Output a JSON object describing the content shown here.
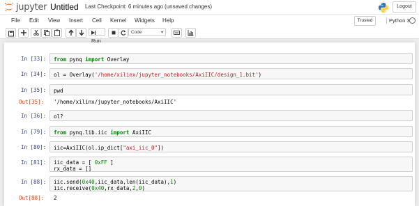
{
  "header": {
    "logo_text": "jupyter",
    "notebook_title": "Untitled",
    "checkpoint": "Last Checkpoint: 6 minutes ago",
    "autosave_status": "(unsaved changes)",
    "logout_label": "Logout"
  },
  "menu": {
    "items": [
      "File",
      "Edit",
      "View",
      "Insert",
      "Cell",
      "Kernel",
      "Widgets",
      "Help"
    ],
    "trusted_label": "Trusted",
    "kernel_name": "Python 3"
  },
  "toolbar": {
    "run_label": "Run",
    "cell_type": "Code",
    "icons": [
      "save-icon",
      "plus-icon",
      "scissors-icon",
      "copy-icon",
      "paste-icon",
      "arrow-up-icon",
      "arrow-down-icon",
      "run-icon",
      "stop-icon",
      "restart-icon",
      "keyboard-icon",
      "chart-icon"
    ]
  },
  "colors": {
    "prompt_in": "#303f9f",
    "prompt_out": "#d84315",
    "keyword": "#008000",
    "string": "#ba2121",
    "logo_orange": "#f37726",
    "python_blue": "#3776ab",
    "python_yellow": "#ffd43b"
  },
  "cells": [
    {
      "prompt": "In [33]:",
      "lines": [
        [
          "from",
          " pynq ",
          "import",
          " Overlay"
        ]
      ]
    },
    {
      "prompt": "In [34]:",
      "lines": [
        [
          "ol = Overlay(",
          "'/home/xilinx/jupyter_notebooks/AxiIIC/design_1.bit'",
          ")"
        ]
      ]
    },
    {
      "prompt": "In [35]:",
      "lines": [
        [
          "pwd"
        ]
      ],
      "output_prompt": "Out[35]:",
      "output": "'/home/xilinx/jupyter_notebooks/AxiIIC'"
    },
    {
      "prompt": "In [36]:",
      "lines": [
        [
          "ol?"
        ]
      ]
    },
    {
      "prompt": "In [79]:",
      "lines": [
        [
          "from",
          " pynq.lib.iic ",
          "import",
          " AxiIIC"
        ]
      ]
    },
    {
      "prompt": "In [80]:",
      "lines": [
        [
          "iic=AxiIIC(ol.ip_dict[",
          "\"axi_iic_0\"",
          "])"
        ]
      ]
    },
    {
      "prompt": "In [81]:",
      "lines": [
        [
          "iic_data = [ ",
          "0xFF",
          " ]"
        ],
        [
          "rx_data = []"
        ]
      ]
    },
    {
      "prompt": "In [88]:",
      "lines": [
        [
          "iic.send(",
          "0x40",
          ",iic_data,len(iic_data),",
          "1",
          ")"
        ],
        [
          "iic.receive(",
          "0x40",
          ",rx_data,",
          "2",
          ",",
          "0",
          ")"
        ]
      ],
      "output_prompt": "Out[88]:",
      "output": "2"
    }
  ]
}
